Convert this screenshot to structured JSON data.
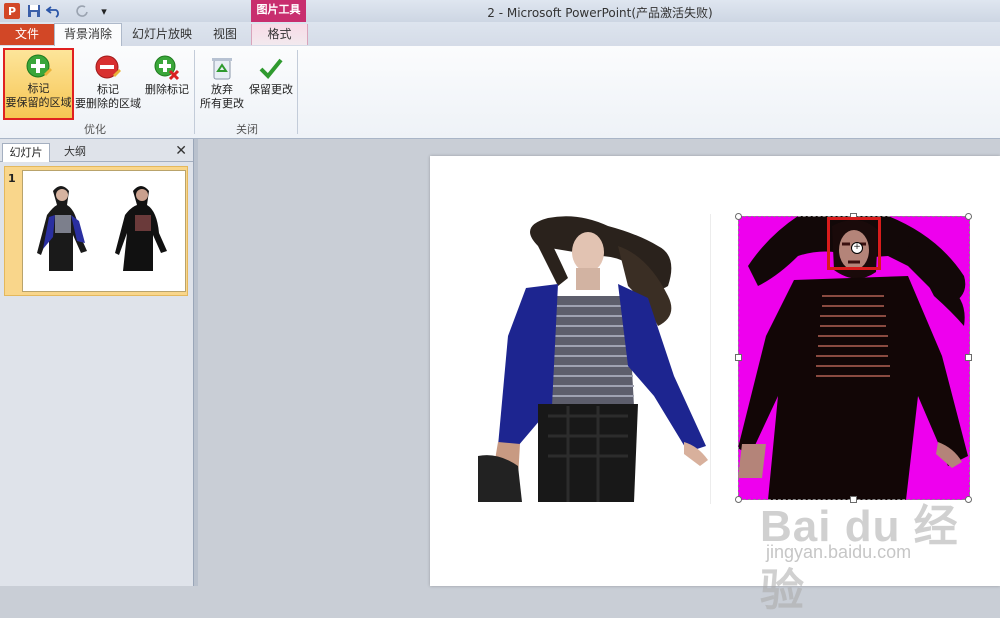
{
  "titlebar": {
    "title": "2 - Microsoft PowerPoint(产品激活失败)",
    "context_group": "图片工具",
    "quick_access": [
      "save-icon",
      "undo-icon",
      "redo-icon",
      "customize-icon"
    ]
  },
  "tabs": {
    "file": "文件",
    "background_removal": "背景消除",
    "slideshow": "幻灯片放映",
    "view": "视图",
    "format": "格式"
  },
  "ribbon": {
    "mark_keep": {
      "line1": "标记",
      "line2": "要保留的区域"
    },
    "mark_remove": {
      "line1": "标记",
      "line2": "要删除的区域"
    },
    "delete_mark": {
      "label": "删除标记"
    },
    "discard": {
      "line1": "放弃",
      "line2": "所有更改"
    },
    "keep_changes": {
      "label": "保留更改"
    },
    "group_refine": "优化",
    "group_close": "关闭"
  },
  "panel": {
    "tab_slides": "幻灯片",
    "tab_outline": "大纲",
    "slide_number": "1"
  },
  "colors": {
    "file_tab": "#d24726",
    "context_group": "#c82e6e",
    "removal_overlay": "#ee00ee",
    "mark_highlight": "#d81c1c"
  },
  "watermark": {
    "logo": "Bai du 经验",
    "url": "jingyan.baidu.com"
  }
}
